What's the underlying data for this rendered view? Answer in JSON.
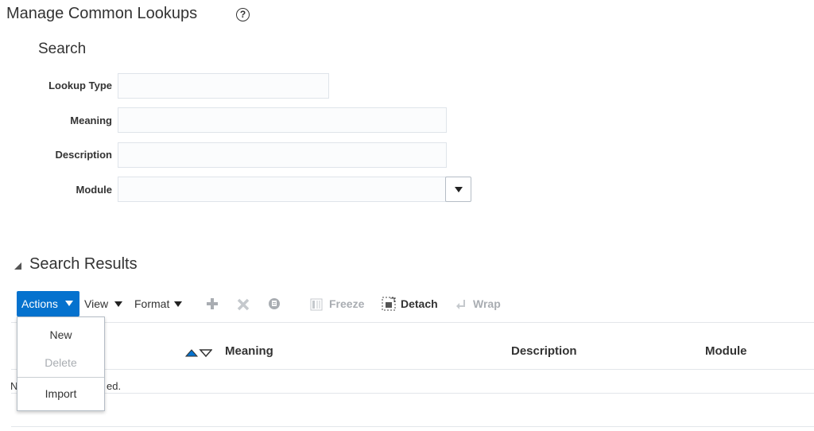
{
  "header": {
    "title": "Manage Common Lookups",
    "help_glyph": "?"
  },
  "search": {
    "heading": "Search",
    "fields": {
      "lookup_type": {
        "label": "Lookup Type",
        "value": ""
      },
      "meaning": {
        "label": "Meaning",
        "value": ""
      },
      "description": {
        "label": "Description",
        "value": ""
      },
      "module": {
        "label": "Module",
        "value": ""
      }
    }
  },
  "results": {
    "heading": "Search Results",
    "toolbar": {
      "actions_label": "Actions",
      "view_label": "View",
      "format_label": "Format",
      "freeze_label": "Freeze",
      "detach_label": "Detach",
      "wrap_label": "Wrap"
    },
    "columns": [
      "Meaning",
      "Description",
      "Module"
    ],
    "empty_visible_start": "N",
    "empty_visible_end": "ed."
  },
  "actions_menu": {
    "items": [
      {
        "label": "New",
        "enabled": true
      },
      {
        "label": "Delete",
        "enabled": false
      },
      {
        "label": "Import",
        "enabled": true
      }
    ]
  },
  "colors": {
    "accent": "#0572ce",
    "disabled": "#a9adb2"
  }
}
